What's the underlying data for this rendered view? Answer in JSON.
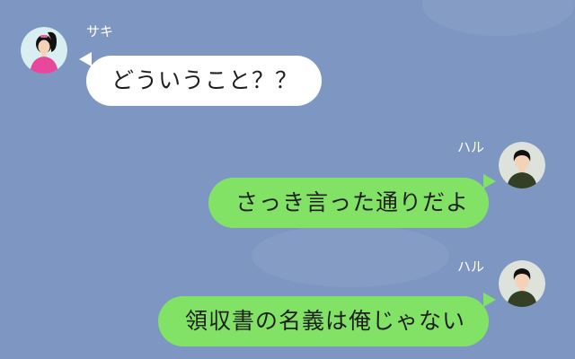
{
  "messages": [
    {
      "sender": "サキ",
      "text": "どういうこと？？",
      "side": "left"
    },
    {
      "sender": "ハル",
      "text": "さっき言った通りだよ",
      "side": "right"
    },
    {
      "sender": "ハル",
      "text": "領収書の名義は俺じゃない",
      "side": "right"
    }
  ],
  "colors": {
    "background": "#7e96c2",
    "incoming_bubble": "#ffffff",
    "outgoing_bubble": "#82e265"
  }
}
